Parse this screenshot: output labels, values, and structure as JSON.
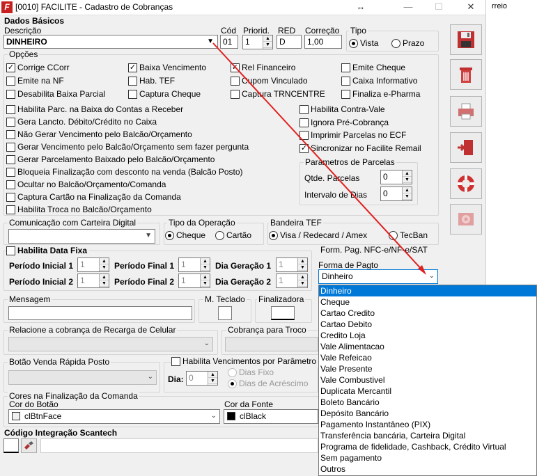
{
  "window": {
    "title": "[0010] FACILITE - Cadastro de Cobranças",
    "move_icon": "↔",
    "minimize": "—",
    "maximize": "☐",
    "close": "✕",
    "bg_window_text": "rreio"
  },
  "dados": {
    "section": "Dados Básicos",
    "descricao_label": "Descrição",
    "descricao_value": "DINHEIRO",
    "cod_label": "Cód",
    "cod_value": "01",
    "prioridade_label": "Priorid.",
    "prioridade_value": "1",
    "red_label": "RED",
    "red_value": "D",
    "correcao_label": "Correção",
    "correcao_value": "1,00",
    "tipo_label": "Tipo",
    "tipo_vista": "Vista",
    "tipo_prazo": "Prazo"
  },
  "opcoes": {
    "title": "Opções",
    "items": [
      {
        "label": "Corrige CCorr",
        "checked": true
      },
      {
        "label": "Baixa Vencimento",
        "checked": true
      },
      {
        "label": "Rel Financeiro",
        "checked": true
      },
      {
        "label": "Emite Cheque",
        "checked": false
      },
      {
        "label": "Emite na NF",
        "checked": false
      },
      {
        "label": "Hab. TEF",
        "checked": false
      },
      {
        "label": "Cupom Vinculado",
        "checked": false
      },
      {
        "label": "Caixa Informativo",
        "checked": false
      },
      {
        "label": "Desabilita Baixa Parcial",
        "checked": false
      },
      {
        "label": "Captura Cheque",
        "checked": false
      },
      {
        "label": "Captura TRNCENTRE",
        "checked": false
      },
      {
        "label": "Finaliza e-Pharma",
        "checked": false
      }
    ],
    "left_items": [
      {
        "label": "Habilita Parc. na Baixa do Contas a Receber",
        "checked": false
      },
      {
        "label": "Gera Lancto. Débito/Crédito no Caixa",
        "checked": false
      },
      {
        "label": "Não Gerar Vencimento pelo Balcão/Orçamento",
        "checked": false
      },
      {
        "label": "Gerar Vencimento pelo Balcão/Orçamento sem fazer pergunta",
        "checked": false
      },
      {
        "label": "Gerar Parcelamento Baixado pelo Balcão/Orçamento",
        "checked": false
      },
      {
        "label": "Bloqueia Finalização com desconto na venda (Balcão Posto)",
        "checked": false
      },
      {
        "label": "Ocultar no Balcão/Orçamento/Comanda",
        "checked": false
      },
      {
        "label": "Captura Cartão na Finalização da Comanda",
        "checked": false
      },
      {
        "label": "Habilita Troca no Balcão/Orçamento",
        "checked": false
      }
    ],
    "right_items": [
      {
        "label": "Habilita Contra-Vale",
        "checked": false
      },
      {
        "label": "Ignora Pré-Cobrança",
        "checked": false
      },
      {
        "label": "Imprimir Parcelas no ECF",
        "checked": false
      },
      {
        "label": "Sincronizar no Facilite Remail",
        "checked": true
      }
    ],
    "parcelas_title": "Parametros de Parcelas",
    "qtde_label": "Qtde. Parcelas",
    "qtde_value": "0",
    "intervalo_label": "Intervalo de Dias",
    "intervalo_value": "0"
  },
  "comunicacao": {
    "label": "Comunicação com Carteira Digital",
    "value": ""
  },
  "operacao": {
    "label": "Tipo da Operação",
    "cheque": "Cheque",
    "cartao": "Cartão"
  },
  "bandeira": {
    "label": "Bandeira TEF",
    "opt1": "Visa / Redecard / Amex",
    "opt2": "TecBan"
  },
  "datafixa": {
    "label": "Habilita Data Fixa",
    "pi1": "Período Inicial 1",
    "pf1": "Período Final 1",
    "dg1": "Dia Geração 1",
    "pi2": "Período Inicial 2",
    "pf2": "Período Final 2",
    "dg2": "Dia Geração 2",
    "v": "1"
  },
  "nfce": {
    "label": "Form. Pag. NFC-e/NF-e/SAT",
    "forma_label": "Forma de Pagto",
    "forma_value": "Dinheiro"
  },
  "mensagem": {
    "label": "Mensagem",
    "mteclado": "M. Teclado",
    "finalizadora": "Finalizadora"
  },
  "recarga": {
    "label": "Relacione a cobrança de Recarga de Celular",
    "troco": "Cobrança para Troco"
  },
  "botao": {
    "label": "Botão Venda Rápida Posto",
    "venc_label": "Habilita Vencimentos por Parâmetro",
    "dia_label": "Dia:",
    "dia_value": "0",
    "dias_fixo": "Dias Fixo",
    "dias_acrescimo": "Dias de Acréscimo"
  },
  "cores": {
    "title": "Cores na Finalização da Comanda",
    "botao_label": "Cor do Botão",
    "botao_value": "clBtnFace",
    "fonte_label": "Cor da Fonte",
    "fonte_value": "clBlack"
  },
  "scantech": {
    "label": "Código Integração Scantech"
  },
  "dropdown": {
    "items": [
      "Dinheiro",
      "Cheque",
      "Cartao Credito",
      "Cartao Debito",
      "Credito Loja",
      "Vale Alimentacao",
      "Vale Refeicao",
      "Vale Presente",
      "Vale Combustivel",
      "Duplicata Mercantil",
      "Boleto Bancário",
      "Depósito Bancário",
      "Pagamento Instantâneo (PIX)",
      "Transferência bancária, Carteira Digital",
      "Programa de fidelidade, Cashback, Crédito Virtual",
      "Sem pagamento",
      "Outros"
    ],
    "selected": 0
  },
  "colors": {
    "selection": "#0078d7",
    "arrow": "#e02020"
  }
}
